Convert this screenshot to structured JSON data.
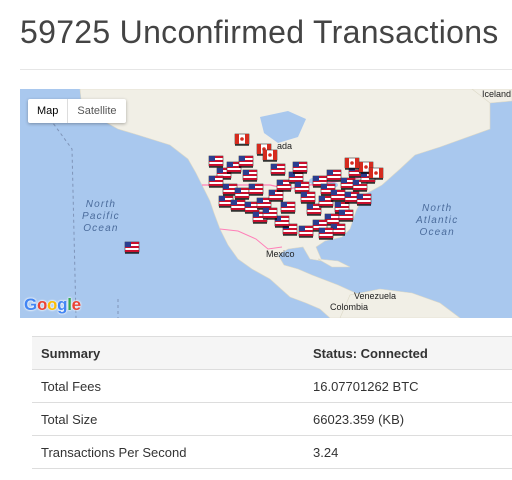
{
  "page": {
    "title": "59725 Unconfirmed Transactions"
  },
  "map": {
    "map_type_button": "Map",
    "satellite_button": "Satellite",
    "labels": {
      "north_pacific": "North\nPacific\nOcean",
      "north_atlantic": "North\nAtlantic\nOcean",
      "canada": "ada",
      "mexico": "Mexico",
      "venezuela": "Venezuela",
      "colombia": "Colombia",
      "iceland": "Iceland"
    },
    "logo": [
      "G",
      "o",
      "o",
      "g",
      "l",
      "e"
    ],
    "marker_icons": [
      "us-flag-marker-icon",
      "canada-flag-marker-icon"
    ],
    "colors": {
      "water": "#a9c8ee",
      "land": "#f1efe6",
      "border": "#ff6fb0"
    }
  },
  "stats": {
    "header": [
      "Summary",
      "Status: Connected"
    ],
    "rows": [
      [
        "Total Fees",
        "16.07701262 BTC"
      ],
      [
        "Total Size",
        "66023.359 (KB)"
      ],
      [
        "Transactions Per Second",
        "3.24"
      ]
    ]
  }
}
